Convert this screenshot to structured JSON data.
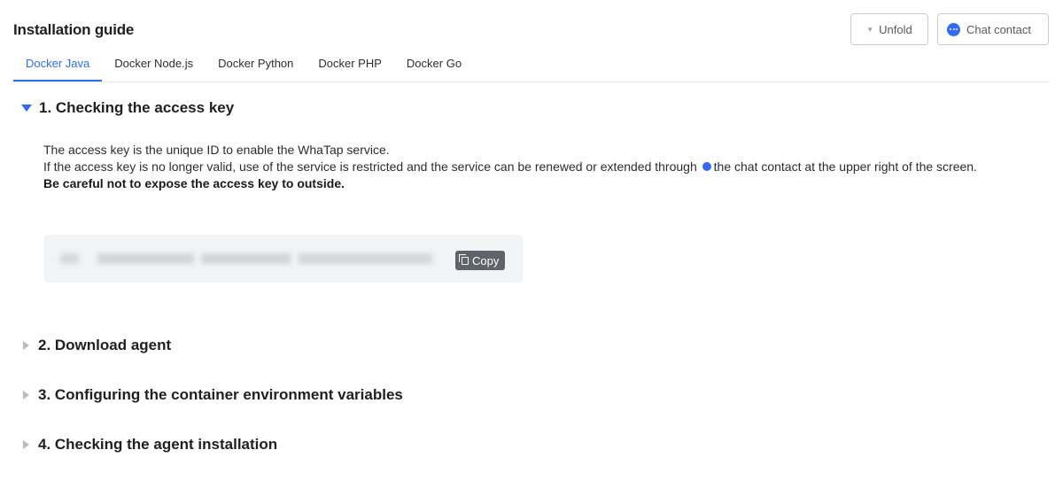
{
  "header": {
    "title": "Installation guide",
    "unfold_label": "Unfold",
    "chat_label": "Chat contact"
  },
  "tabs": [
    {
      "label": "Docker Java",
      "active": true
    },
    {
      "label": "Docker Node.js",
      "active": false
    },
    {
      "label": "Docker Python",
      "active": false
    },
    {
      "label": "Docker PHP",
      "active": false
    },
    {
      "label": "Docker Go",
      "active": false
    }
  ],
  "sections": [
    {
      "title": "1. Checking the access key",
      "expanded": true
    },
    {
      "title": "2. Download agent",
      "expanded": false
    },
    {
      "title": "3. Configuring the container environment variables",
      "expanded": false
    },
    {
      "title": "4. Checking the agent installation",
      "expanded": false
    }
  ],
  "access_key": {
    "line1": "The access key is the unique ID to enable the WhaTap service.",
    "line2_before": "If the access key is no longer valid, use of the service is restricted and the service can be renewed or extended through ",
    "line2_after": "the chat contact at the upper right of the screen.",
    "warning": "Be careful not to expose the access key to outside.",
    "copy_label": "Copy"
  },
  "colors": {
    "accent": "#2f6bf6",
    "copy_button": "#5f646b",
    "key_box": "#f2f3f5"
  },
  "icons": [
    "caret-down-icon",
    "chat-icon",
    "copy-icon",
    "expand-triangle-icon",
    "collapse-triangle-icon"
  ]
}
